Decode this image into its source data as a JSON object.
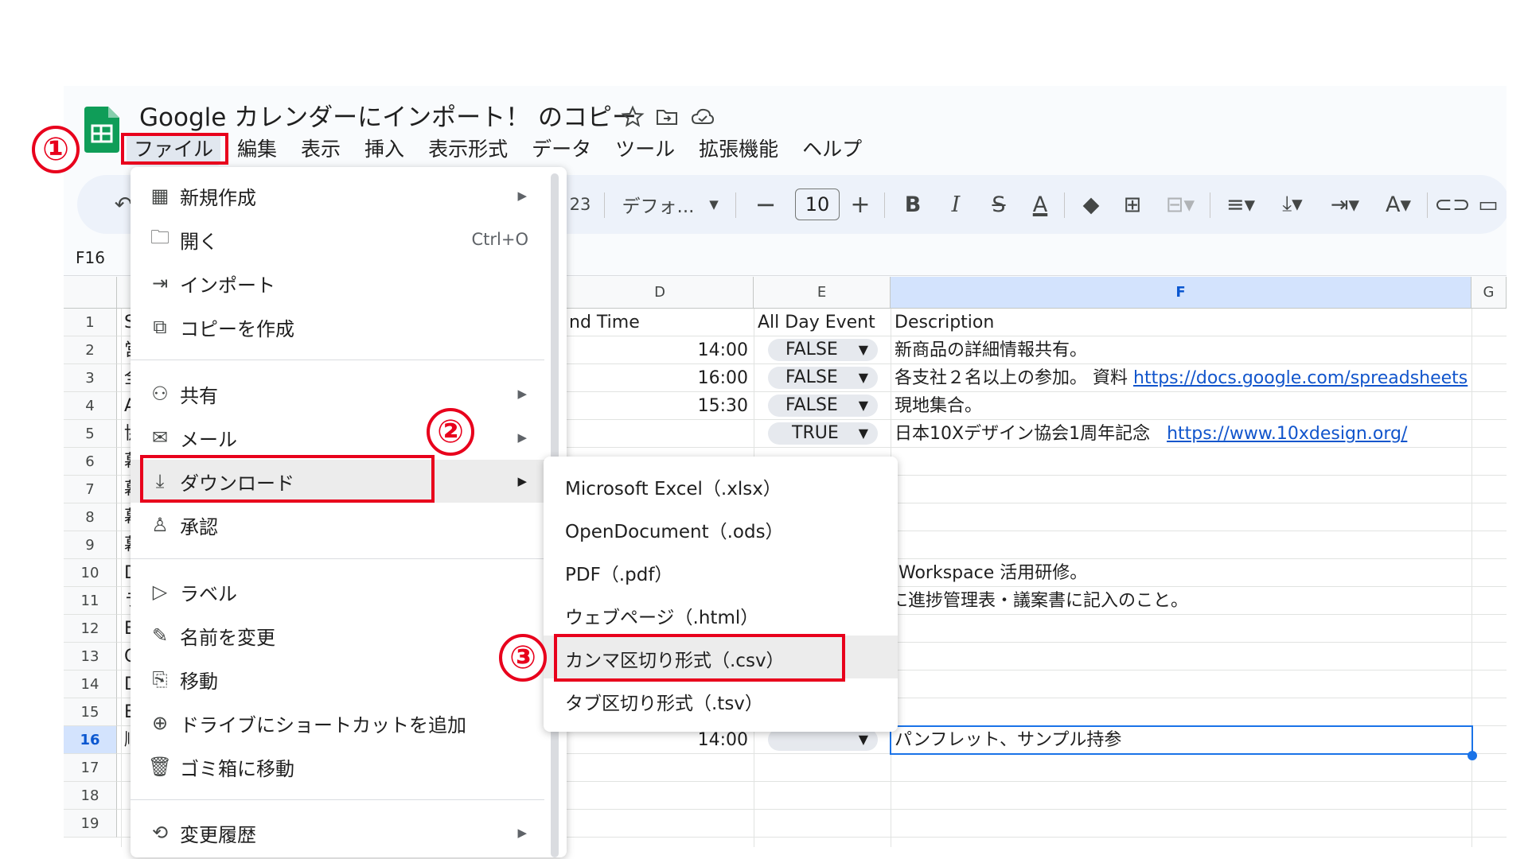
{
  "doc": {
    "title": "Google カレンダーにインポート！ のコピー",
    "star_icon": "star-icon",
    "move_icon": "folder-move-icon",
    "cloud_icon": "cloud-saved-icon"
  },
  "menubar": [
    "ファイル",
    "編集",
    "表示",
    "挿入",
    "表示形式",
    "データ",
    "ツール",
    "拡張機能",
    "ヘルプ"
  ],
  "toolbar": {
    "format_number": "23",
    "font_name": "デフォ...",
    "font_size": "10",
    "minus": "−",
    "plus": "+",
    "bold": "B",
    "italic": "I"
  },
  "namebox": "F16",
  "columns": [
    "D",
    "E",
    "F",
    "G"
  ],
  "rows": [
    "1",
    "2",
    "3",
    "4",
    "5",
    "6",
    "7",
    "8",
    "9",
    "10",
    "11",
    "12",
    "13",
    "14",
    "15",
    "16",
    "17",
    "18",
    "19"
  ],
  "col_b_partial": [
    "S",
    "営",
    "全",
    "A",
    "協",
    "幕",
    "幕",
    "幕",
    "幕",
    "D",
    "ラ",
    "E",
    "C",
    "D",
    "E",
    "順"
  ],
  "cells": {
    "r1": {
      "d": "nd Time",
      "e": "All Day Event",
      "f": "Description"
    },
    "r2": {
      "d": "14:00",
      "e": "FALSE",
      "f": "新商品の詳細情報共有。"
    },
    "r3": {
      "d": "16:00",
      "e": "FALSE",
      "f": "各支社２名以上の参加。 資料",
      "f_link": "https://docs.google.com/spreadsheets"
    },
    "r4": {
      "d": "15:30",
      "e": "FALSE",
      "f": "現地集合。"
    },
    "r5": {
      "e": "TRUE",
      "f": "日本10Xデザイン協会1周年記念",
      "f_link": "https://www.10xdesign.org/"
    },
    "r10": {
      "f": "Workspace 活用研修。"
    },
    "r11": {
      "f": "に進捗管理表・議案書に記入のこと。"
    },
    "r16": {
      "d": "14:00",
      "e": "",
      "f": "パンフレット、サンプル持参"
    }
  },
  "file_menu": {
    "new": "新規作成",
    "open": "開く",
    "open_shortcut": "Ctrl+O",
    "import": "インポート",
    "copy": "コピーを作成",
    "share": "共有",
    "mail": "メール",
    "download": "ダウンロード",
    "approve": "承認",
    "label": "ラベル",
    "rename": "名前を変更",
    "move": "移動",
    "shortcut": "ドライブにショートカットを追加",
    "trash": "ゴミ箱に移動",
    "history": "変更履歴"
  },
  "download_menu": [
    "Microsoft Excel（.xlsx）",
    "OpenDocument（.ods）",
    "PDF（.pdf）",
    "ウェブページ（.html）",
    "カンマ区切り形式（.csv）",
    "タブ区切り形式（.tsv）"
  ],
  "annotations": [
    "①",
    "②",
    "③"
  ],
  "colors": {
    "accent": "#1a73e8",
    "annotation": "#e8001c",
    "sheets_green": "#0f9d58",
    "link": "#1155cc"
  }
}
